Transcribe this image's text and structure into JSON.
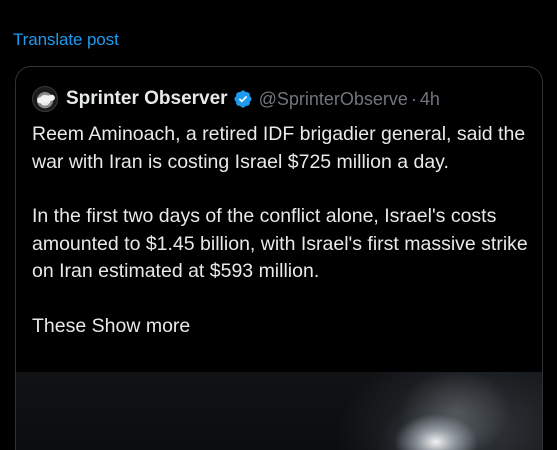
{
  "translate": {
    "label": "Translate post"
  },
  "quote": {
    "author": {
      "display_name": "Sprinter Observer",
      "verified_icon": "verified-badge-icon",
      "handle": "@SprinterObserve",
      "separator": "·",
      "time": "4h"
    },
    "paragraphs": [
      "Reem Aminoach, a retired IDF brigadier general, said the war with Iran is costing Israel $725 million a day.",
      "In the first two days of the conflict alone, Israel's costs amounted to $1.45 billion, with Israel's first massive strike on Iran estimated at $593 million."
    ],
    "truncated_text": "These",
    "show_more": "Show more",
    "media": {
      "type": "image"
    }
  },
  "colors": {
    "background": "#000000",
    "link": "#1d9bf0",
    "text": "#e7e9ea",
    "muted": "#71767b",
    "border": "#2f3336"
  }
}
